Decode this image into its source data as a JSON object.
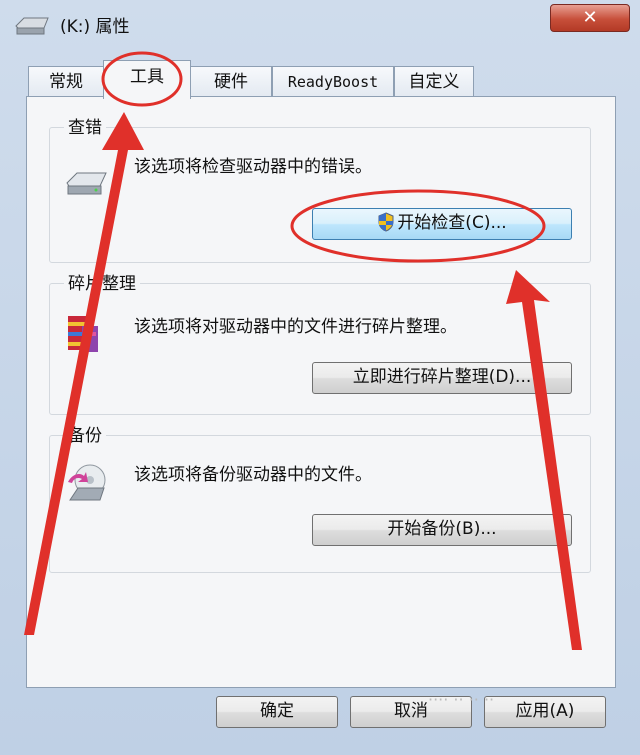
{
  "window": {
    "title": "(K:) 属性",
    "close_label": "✕"
  },
  "tabs": [
    {
      "label": "常规"
    },
    {
      "label": "工具"
    },
    {
      "label": "硬件"
    },
    {
      "label": "ReadyBoost"
    },
    {
      "label": "自定义"
    }
  ],
  "active_tab": "工具",
  "groups": {
    "error_check": {
      "title": "查错",
      "description": "该选项将检查驱动器中的错误。",
      "button": "开始检查(C)..."
    },
    "defrag": {
      "title": "碎片整理",
      "description": "该选项将对驱动器中的文件进行碎片整理。",
      "button": "立即进行碎片整理(D)..."
    },
    "backup": {
      "title": "备份",
      "description": "该选项将备份驱动器中的文件。",
      "button": "开始备份(B)..."
    }
  },
  "footer": {
    "ok": "确定",
    "cancel": "取消",
    "apply": "应用(A)"
  },
  "annotation": {
    "color": "#e0302a"
  }
}
